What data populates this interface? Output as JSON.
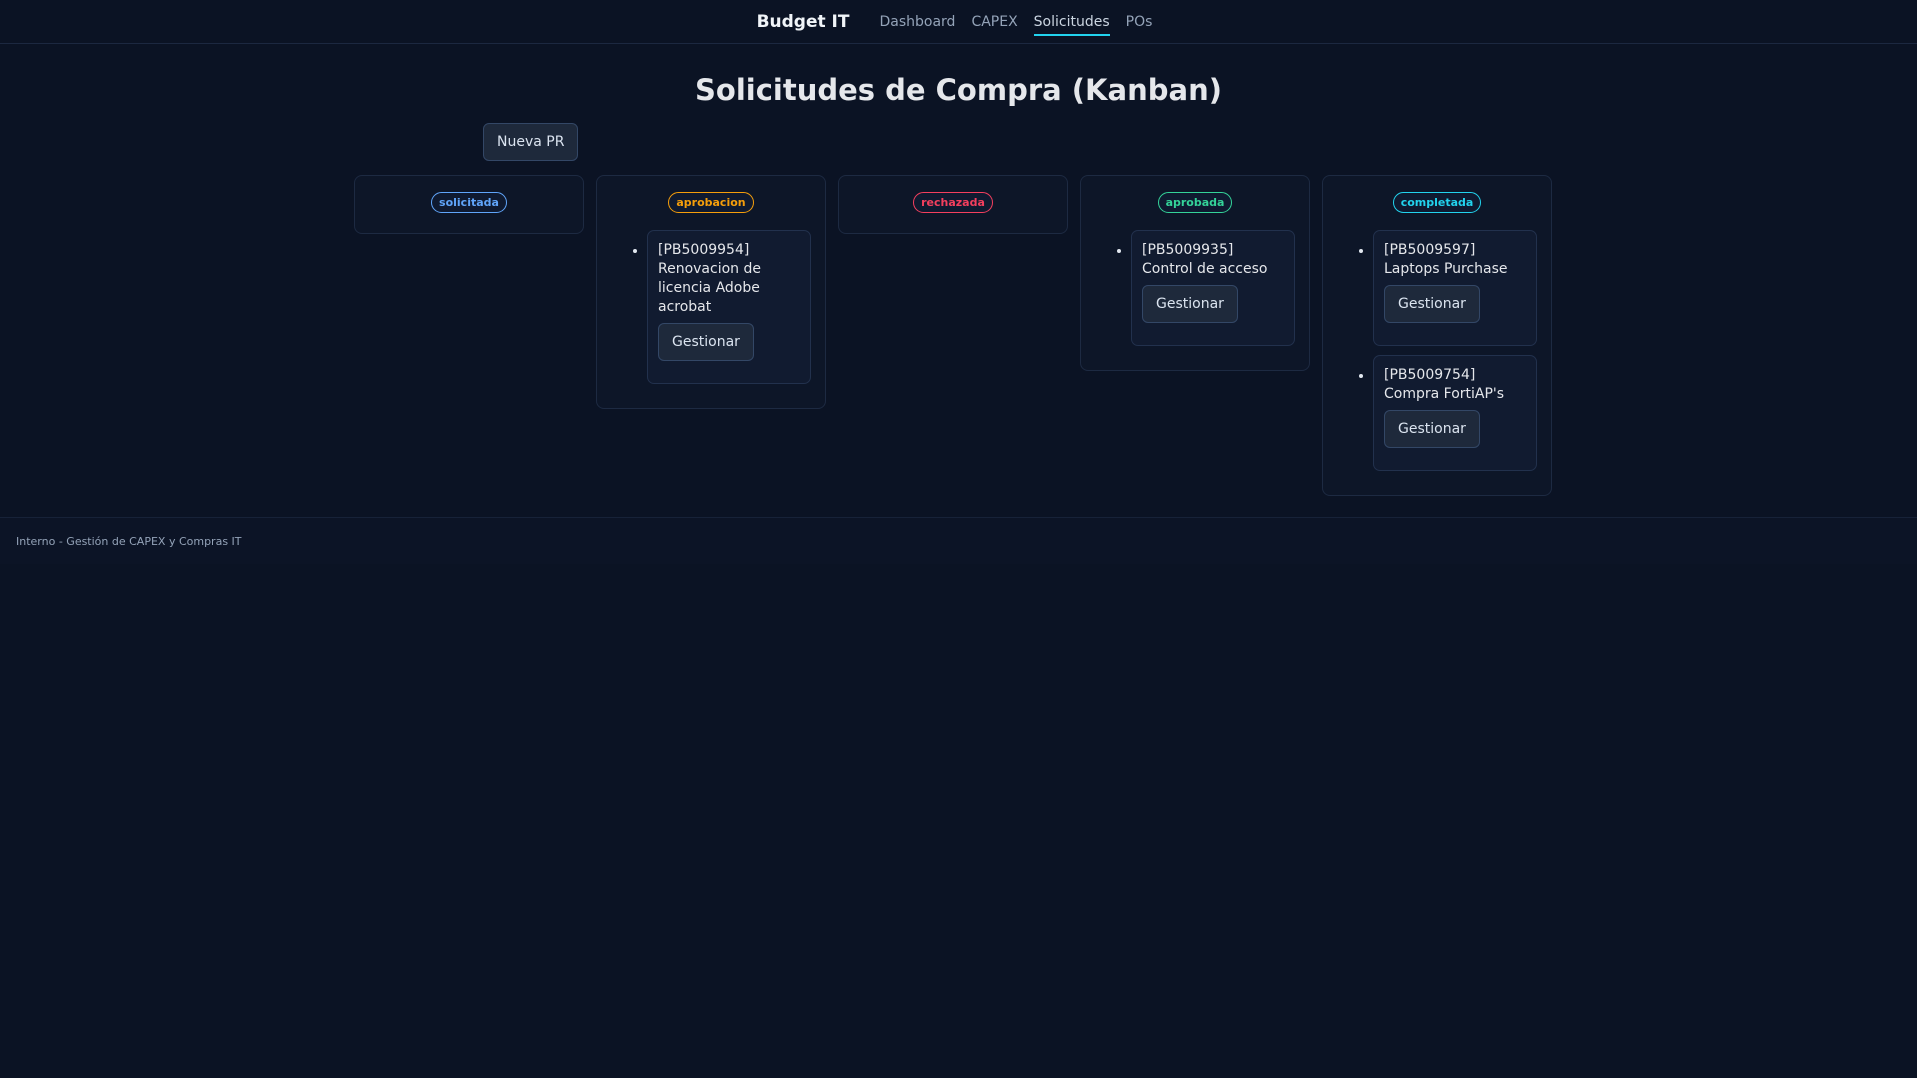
{
  "header": {
    "brand": "Budget IT",
    "nav": [
      {
        "label": "Dashboard",
        "active": false
      },
      {
        "label": "CAPEX",
        "active": false
      },
      {
        "label": "Solicitudes",
        "active": true
      },
      {
        "label": "POs",
        "active": false
      }
    ]
  },
  "page": {
    "title": "Solicitudes de Compra (Kanban)",
    "new_button": "Nueva PR"
  },
  "columns": [
    {
      "status": "solicitada",
      "color": "#60a5fa",
      "cards": []
    },
    {
      "status": "aprobacion",
      "color": "#f59e0b",
      "cards": [
        {
          "code": "[PB5009954]",
          "title": "Renovacion de licencia Adobe acrobat",
          "action": "Gestionar"
        }
      ]
    },
    {
      "status": "rechazada",
      "color": "#f43f5e",
      "cards": []
    },
    {
      "status": "aprobada",
      "color": "#34d399",
      "cards": [
        {
          "code": "[PB5009935]",
          "title": "Control de acceso",
          "action": "Gestionar"
        }
      ]
    },
    {
      "status": "completada",
      "color": "#22d3ee",
      "cards": [
        {
          "code": "[PB5009597]",
          "title": "Laptops Purchase",
          "action": "Gestionar"
        },
        {
          "code": "[PB5009754]",
          "title": "Compra FortiAP's",
          "action": "Gestionar"
        }
      ]
    }
  ],
  "footer": {
    "text": "Interno - Gestión de CAPEX y Compras IT"
  }
}
